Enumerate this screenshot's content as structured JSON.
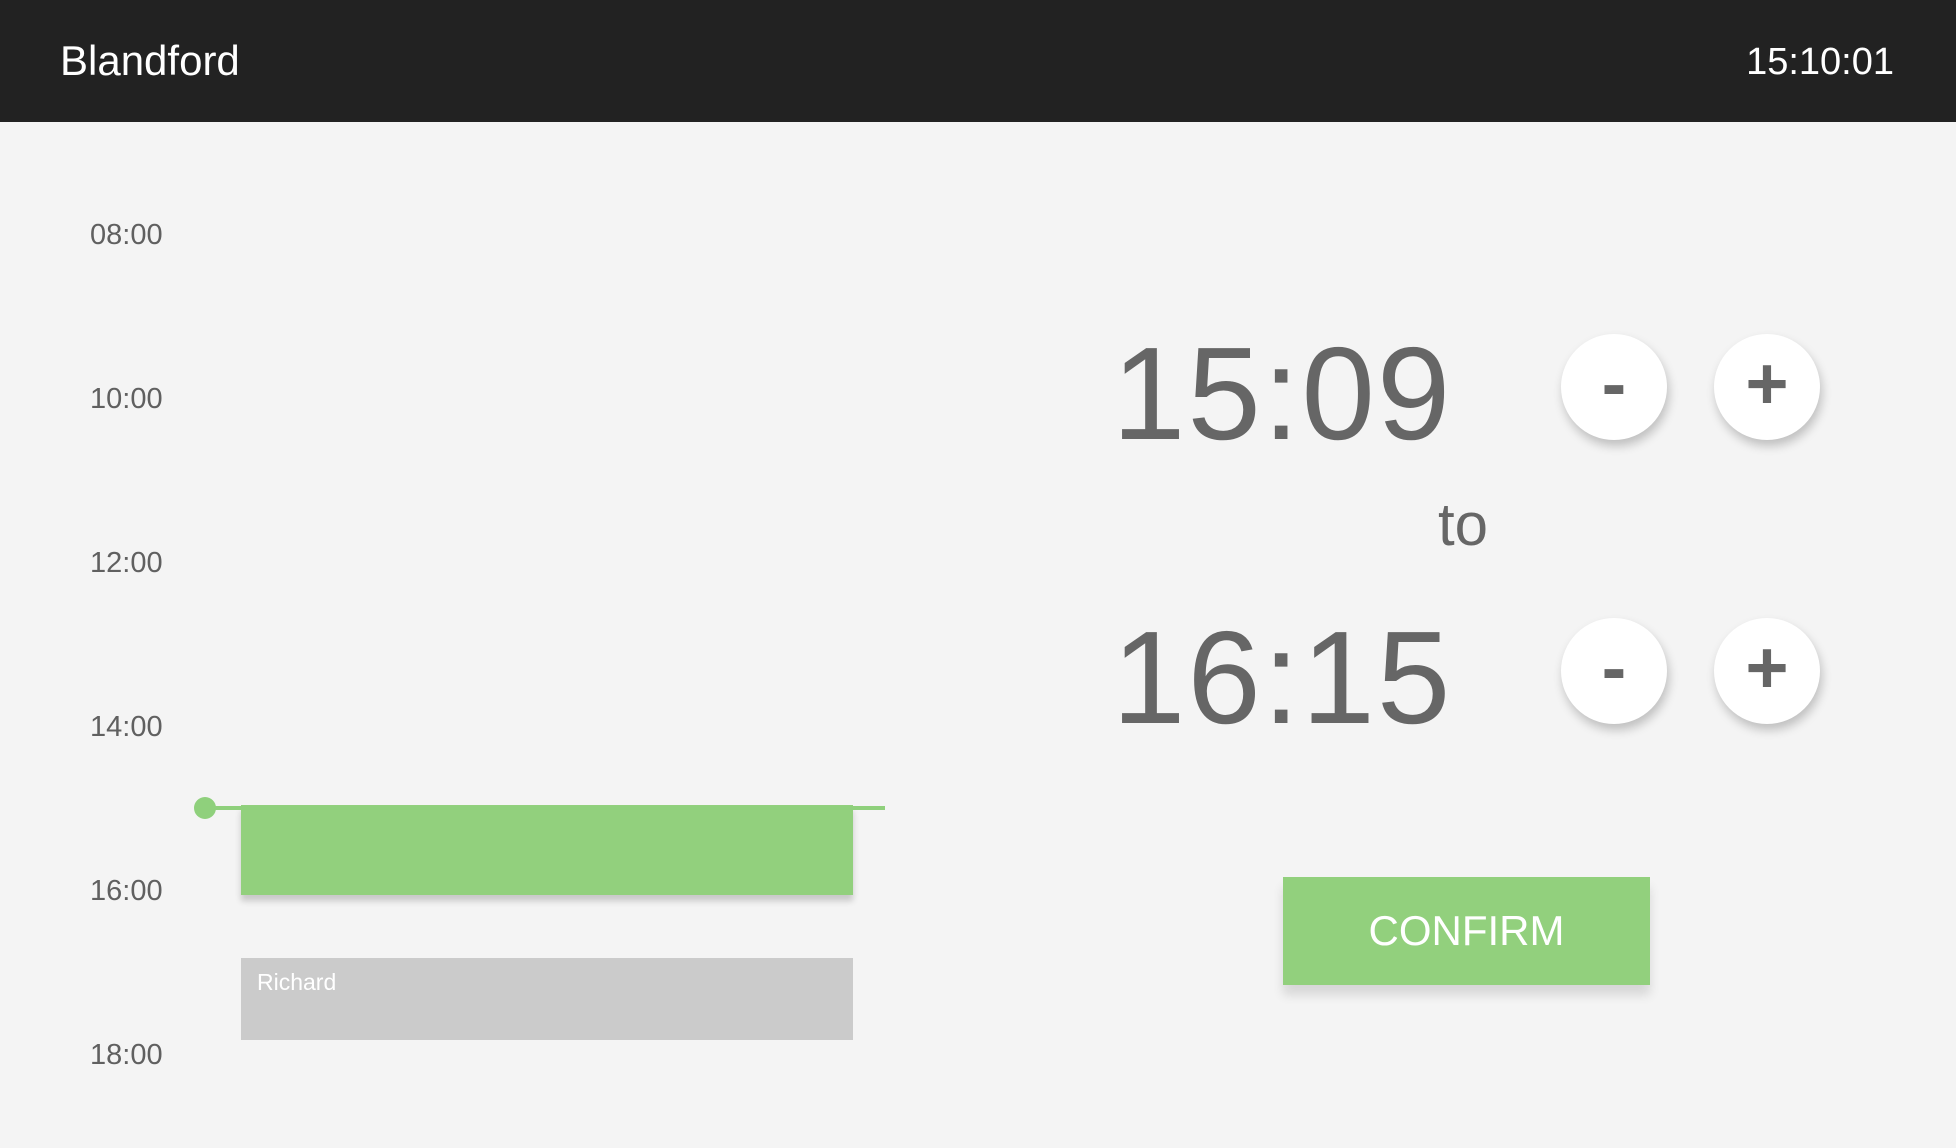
{
  "header": {
    "room_name": "Blandford",
    "clock": "15:10:01"
  },
  "timeline": {
    "hour_labels": [
      "08:00",
      "10:00",
      "12:00",
      "14:00",
      "16:00",
      "18:00"
    ],
    "current_time_marker": "15:10",
    "new_booking": {
      "start": "15:09",
      "end": "16:15"
    },
    "existing_booking": {
      "owner": "Richard"
    }
  },
  "editor": {
    "start_time": "15:09",
    "separator": "to",
    "end_time": "16:15",
    "decrement_label": "-",
    "increment_label": "+",
    "confirm_label": "CONFIRM"
  },
  "colors": {
    "topbar": "#222222",
    "accent_green": "#92d07d",
    "existing_booking_gray": "#cbcbcb",
    "background": "#f4f4f4"
  }
}
